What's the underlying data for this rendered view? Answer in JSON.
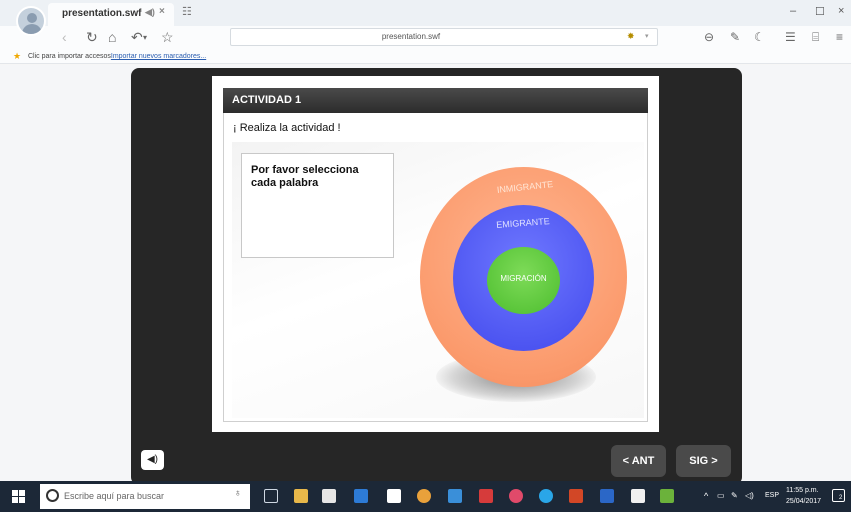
{
  "browser": {
    "tab": {
      "title": "presentation.swf"
    },
    "url": "presentation.swf",
    "bookmarks_prompt": "Clic para importar accesos",
    "bookmarks_link": "Importar nuevos marcadores..."
  },
  "activity": {
    "title": "ACTIVIDAD 1",
    "instruction": "¡ Realiza la actividad !",
    "prompt": "Por favor selecciona cada palabra",
    "rings": {
      "outer": "INMIGRANTE",
      "middle": "EMIGRANTE",
      "inner": "MIGRACIÓN"
    },
    "colors": {
      "outer": "#fb9a6c",
      "middle": "#4a52f0",
      "inner": "#4cbd2e"
    }
  },
  "player": {
    "prev_label": "< ANT",
    "next_label": "SIG >"
  },
  "taskbar": {
    "search_placeholder": "Escribe aquí para buscar",
    "language": "ESP",
    "time": "11:55 p.m.",
    "date": "25/04/2017",
    "notifications": "2"
  }
}
